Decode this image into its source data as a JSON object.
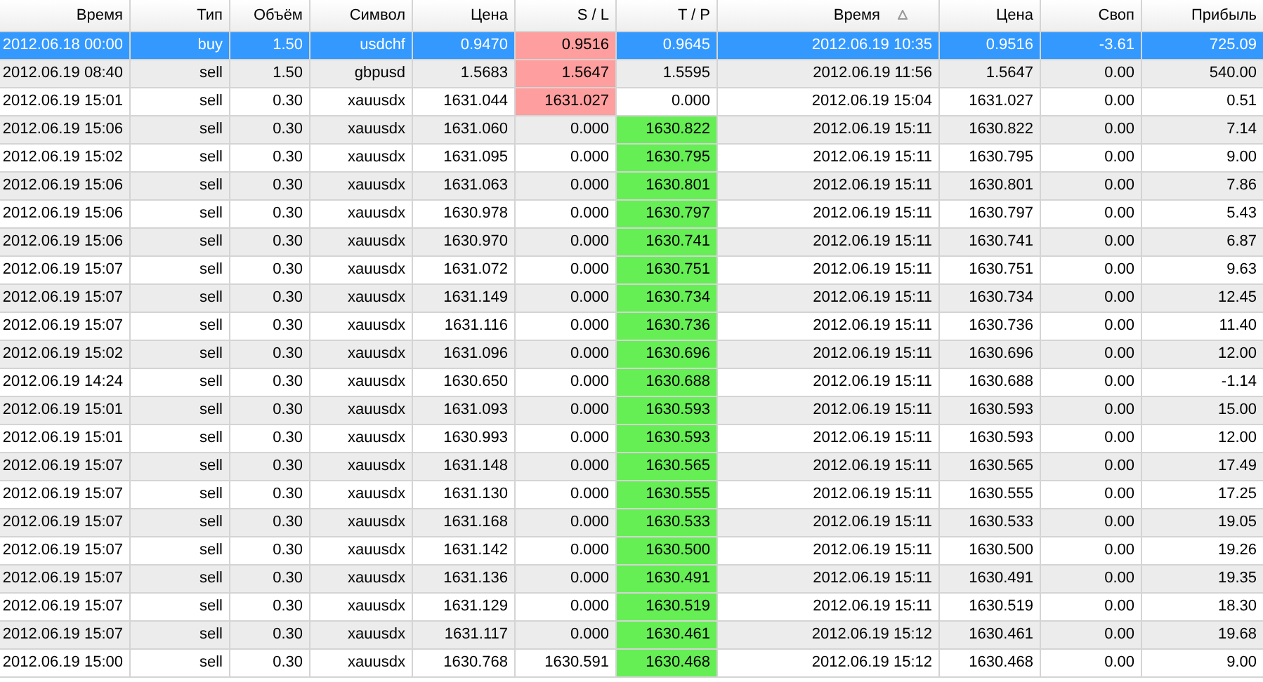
{
  "table": {
    "columns": [
      {
        "label": "Время",
        "sorted": false
      },
      {
        "label": "Тип",
        "sorted": false
      },
      {
        "label": "Объём",
        "sorted": false
      },
      {
        "label": "Символ",
        "sorted": false
      },
      {
        "label": "Цена",
        "sorted": false
      },
      {
        "label": "S / L",
        "sorted": false
      },
      {
        "label": "T / P",
        "sorted": false
      },
      {
        "label": "Время",
        "sorted": true
      },
      {
        "label": "Цена",
        "sorted": false
      },
      {
        "label": "Своп",
        "sorted": false
      },
      {
        "label": "Прибыль",
        "sorted": false
      }
    ],
    "rows": [
      {
        "selected": true,
        "sl_hit": true,
        "tp_hit": false,
        "cells": [
          "2012.06.18 00:00",
          "buy",
          "1.50",
          "usdchf",
          "0.9470",
          "0.9516",
          "0.9645",
          "2012.06.19 10:35",
          "0.9516",
          "-3.61",
          "725.09"
        ]
      },
      {
        "selected": false,
        "sl_hit": true,
        "tp_hit": false,
        "cells": [
          "2012.06.19 08:40",
          "sell",
          "1.50",
          "gbpusd",
          "1.5683",
          "1.5647",
          "1.5595",
          "2012.06.19 11:56",
          "1.5647",
          "0.00",
          "540.00"
        ]
      },
      {
        "selected": false,
        "sl_hit": true,
        "tp_hit": false,
        "cells": [
          "2012.06.19 15:01",
          "sell",
          "0.30",
          "xauusdx",
          "1631.044",
          "1631.027",
          "0.000",
          "2012.06.19 15:04",
          "1631.027",
          "0.00",
          "0.51"
        ]
      },
      {
        "selected": false,
        "sl_hit": false,
        "tp_hit": true,
        "cells": [
          "2012.06.19 15:06",
          "sell",
          "0.30",
          "xauusdx",
          "1631.060",
          "0.000",
          "1630.822",
          "2012.06.19 15:11",
          "1630.822",
          "0.00",
          "7.14"
        ]
      },
      {
        "selected": false,
        "sl_hit": false,
        "tp_hit": true,
        "cells": [
          "2012.06.19 15:02",
          "sell",
          "0.30",
          "xauusdx",
          "1631.095",
          "0.000",
          "1630.795",
          "2012.06.19 15:11",
          "1630.795",
          "0.00",
          "9.00"
        ]
      },
      {
        "selected": false,
        "sl_hit": false,
        "tp_hit": true,
        "cells": [
          "2012.06.19 15:06",
          "sell",
          "0.30",
          "xauusdx",
          "1631.063",
          "0.000",
          "1630.801",
          "2012.06.19 15:11",
          "1630.801",
          "0.00",
          "7.86"
        ]
      },
      {
        "selected": false,
        "sl_hit": false,
        "tp_hit": true,
        "cells": [
          "2012.06.19 15:06",
          "sell",
          "0.30",
          "xauusdx",
          "1630.978",
          "0.000",
          "1630.797",
          "2012.06.19 15:11",
          "1630.797",
          "0.00",
          "5.43"
        ]
      },
      {
        "selected": false,
        "sl_hit": false,
        "tp_hit": true,
        "cells": [
          "2012.06.19 15:06",
          "sell",
          "0.30",
          "xauusdx",
          "1630.970",
          "0.000",
          "1630.741",
          "2012.06.19 15:11",
          "1630.741",
          "0.00",
          "6.87"
        ]
      },
      {
        "selected": false,
        "sl_hit": false,
        "tp_hit": true,
        "cells": [
          "2012.06.19 15:07",
          "sell",
          "0.30",
          "xauusdx",
          "1631.072",
          "0.000",
          "1630.751",
          "2012.06.19 15:11",
          "1630.751",
          "0.00",
          "9.63"
        ]
      },
      {
        "selected": false,
        "sl_hit": false,
        "tp_hit": true,
        "cells": [
          "2012.06.19 15:07",
          "sell",
          "0.30",
          "xauusdx",
          "1631.149",
          "0.000",
          "1630.734",
          "2012.06.19 15:11",
          "1630.734",
          "0.00",
          "12.45"
        ]
      },
      {
        "selected": false,
        "sl_hit": false,
        "tp_hit": true,
        "cells": [
          "2012.06.19 15:07",
          "sell",
          "0.30",
          "xauusdx",
          "1631.116",
          "0.000",
          "1630.736",
          "2012.06.19 15:11",
          "1630.736",
          "0.00",
          "11.40"
        ]
      },
      {
        "selected": false,
        "sl_hit": false,
        "tp_hit": true,
        "cells": [
          "2012.06.19 15:02",
          "sell",
          "0.30",
          "xauusdx",
          "1631.096",
          "0.000",
          "1630.696",
          "2012.06.19 15:11",
          "1630.696",
          "0.00",
          "12.00"
        ]
      },
      {
        "selected": false,
        "sl_hit": false,
        "tp_hit": true,
        "cells": [
          "2012.06.19 14:24",
          "sell",
          "0.30",
          "xauusdx",
          "1630.650",
          "0.000",
          "1630.688",
          "2012.06.19 15:11",
          "1630.688",
          "0.00",
          "-1.14"
        ]
      },
      {
        "selected": false,
        "sl_hit": false,
        "tp_hit": true,
        "cells": [
          "2012.06.19 15:01",
          "sell",
          "0.30",
          "xauusdx",
          "1631.093",
          "0.000",
          "1630.593",
          "2012.06.19 15:11",
          "1630.593",
          "0.00",
          "15.00"
        ]
      },
      {
        "selected": false,
        "sl_hit": false,
        "tp_hit": true,
        "cells": [
          "2012.06.19 15:01",
          "sell",
          "0.30",
          "xauusdx",
          "1630.993",
          "0.000",
          "1630.593",
          "2012.06.19 15:11",
          "1630.593",
          "0.00",
          "12.00"
        ]
      },
      {
        "selected": false,
        "sl_hit": false,
        "tp_hit": true,
        "cells": [
          "2012.06.19 15:07",
          "sell",
          "0.30",
          "xauusdx",
          "1631.148",
          "0.000",
          "1630.565",
          "2012.06.19 15:11",
          "1630.565",
          "0.00",
          "17.49"
        ]
      },
      {
        "selected": false,
        "sl_hit": false,
        "tp_hit": true,
        "cells": [
          "2012.06.19 15:07",
          "sell",
          "0.30",
          "xauusdx",
          "1631.130",
          "0.000",
          "1630.555",
          "2012.06.19 15:11",
          "1630.555",
          "0.00",
          "17.25"
        ]
      },
      {
        "selected": false,
        "sl_hit": false,
        "tp_hit": true,
        "cells": [
          "2012.06.19 15:07",
          "sell",
          "0.30",
          "xauusdx",
          "1631.168",
          "0.000",
          "1630.533",
          "2012.06.19 15:11",
          "1630.533",
          "0.00",
          "19.05"
        ]
      },
      {
        "selected": false,
        "sl_hit": false,
        "tp_hit": true,
        "cells": [
          "2012.06.19 15:07",
          "sell",
          "0.30",
          "xauusdx",
          "1631.142",
          "0.000",
          "1630.500",
          "2012.06.19 15:11",
          "1630.500",
          "0.00",
          "19.26"
        ]
      },
      {
        "selected": false,
        "sl_hit": false,
        "tp_hit": true,
        "cells": [
          "2012.06.19 15:07",
          "sell",
          "0.30",
          "xauusdx",
          "1631.136",
          "0.000",
          "1630.491",
          "2012.06.19 15:11",
          "1630.491",
          "0.00",
          "19.35"
        ]
      },
      {
        "selected": false,
        "sl_hit": false,
        "tp_hit": true,
        "cells": [
          "2012.06.19 15:07",
          "sell",
          "0.30",
          "xauusdx",
          "1631.129",
          "0.000",
          "1630.519",
          "2012.06.19 15:11",
          "1630.519",
          "0.00",
          "18.30"
        ]
      },
      {
        "selected": false,
        "sl_hit": false,
        "tp_hit": true,
        "cells": [
          "2012.06.19 15:07",
          "sell",
          "0.30",
          "xauusdx",
          "1631.117",
          "0.000",
          "1630.461",
          "2012.06.19 15:12",
          "1630.461",
          "0.00",
          "19.68"
        ]
      },
      {
        "selected": false,
        "sl_hit": false,
        "tp_hit": true,
        "cells": [
          "2012.06.19 15:00",
          "sell",
          "0.30",
          "xauusdx",
          "1630.768",
          "1630.591",
          "1630.468",
          "2012.06.19 15:12",
          "1630.468",
          "0.00",
          "9.00"
        ]
      }
    ]
  }
}
